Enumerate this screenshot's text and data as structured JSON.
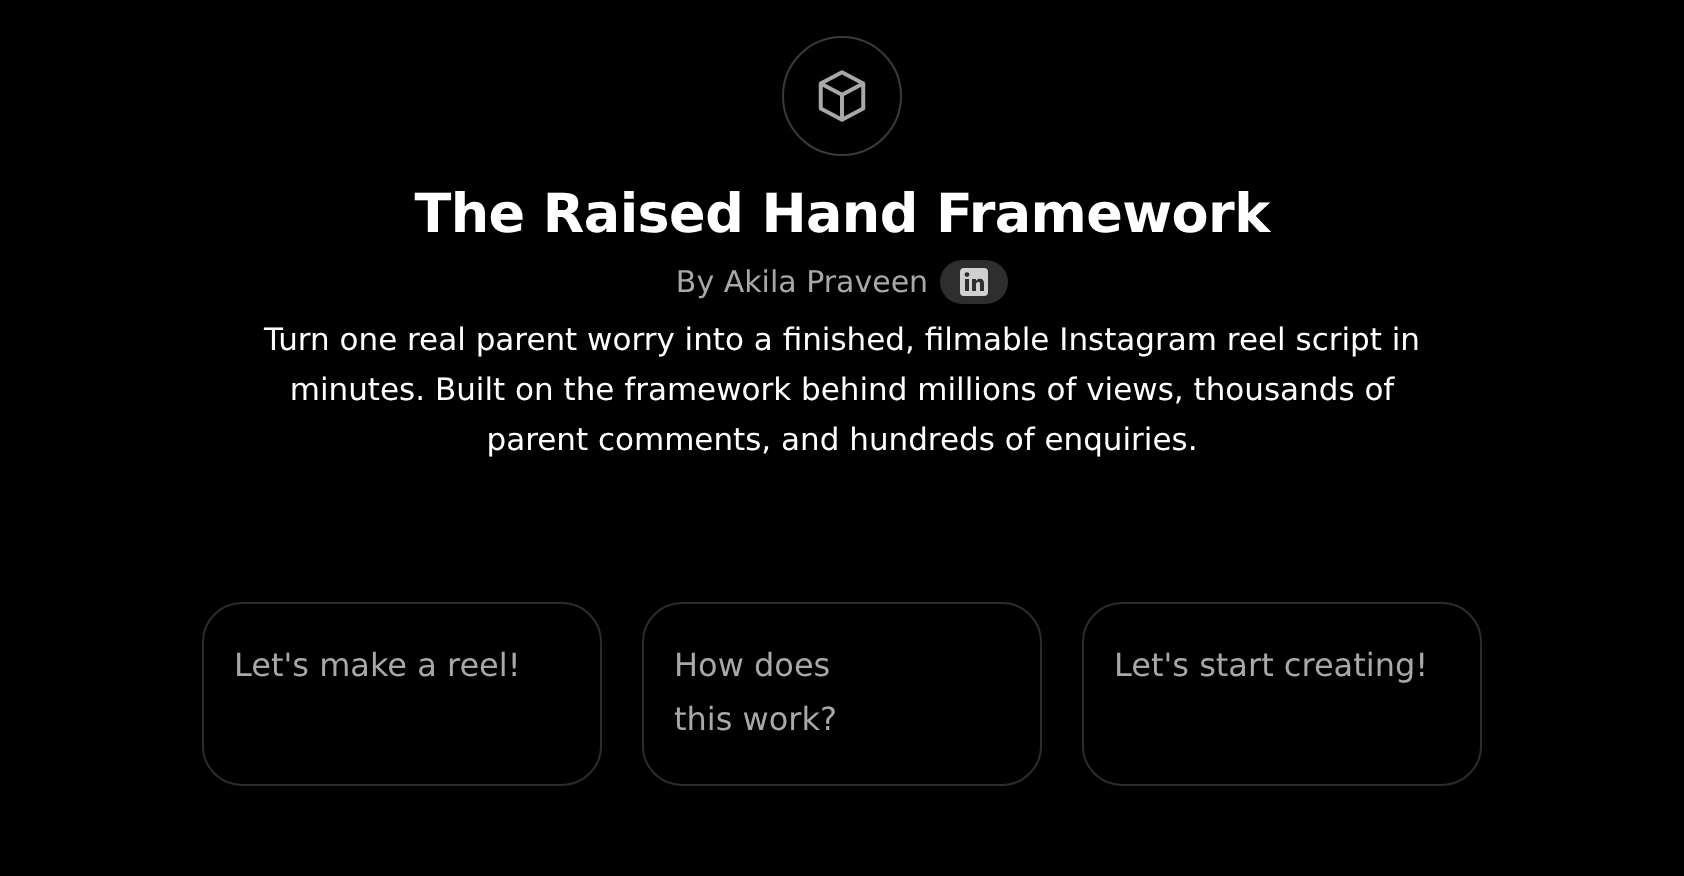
{
  "header": {
    "title": "The Raised Hand Framework",
    "byline": "By Akila Praveen",
    "description": "Turn one real parent worry into a finished, filmable Instagram reel script in minutes. Built on the framework behind millions of views, thousands of parent comments, and hundreds of enquiries."
  },
  "suggestions": [
    {
      "label": "Let's make a reel!"
    },
    {
      "label": "How does\nthis work?"
    },
    {
      "label": "Let's start creating!"
    }
  ]
}
